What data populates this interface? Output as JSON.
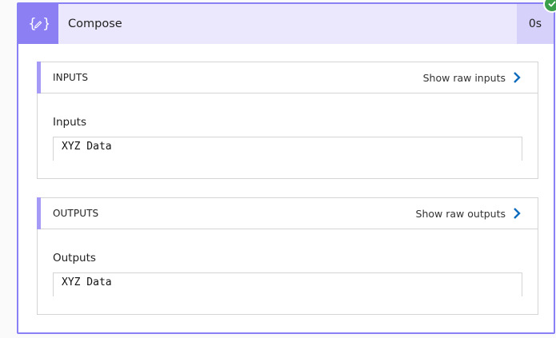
{
  "action": {
    "title": "Compose",
    "duration": "0s",
    "icon": "compose-curly-braces-icon",
    "accent_color": "#8b7ff3",
    "header_bg": "#ebe8fd",
    "status": "succeeded",
    "status_color": "#3a9e4a"
  },
  "inputs": {
    "section_title": "INPUTS",
    "raw_link_label": "Show raw inputs",
    "field_label": "Inputs",
    "field_value": "XYZ Data"
  },
  "outputs": {
    "section_title": "OUTPUTS",
    "raw_link_label": "Show raw outputs",
    "field_label": "Outputs",
    "field_value": "XYZ Data"
  },
  "link_color": "#0f6cbd"
}
